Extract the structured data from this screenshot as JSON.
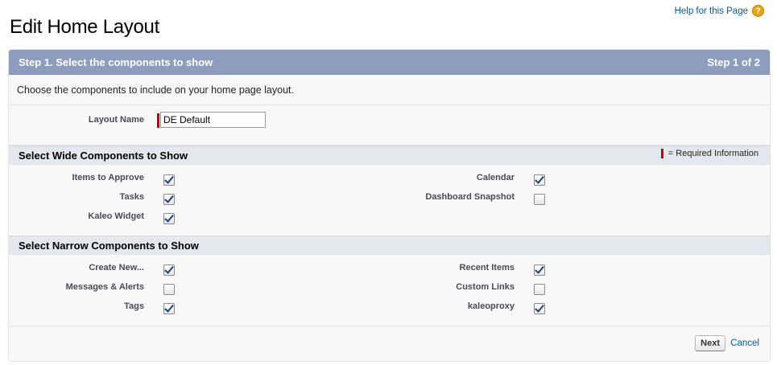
{
  "page": {
    "title": "Edit Home Layout",
    "help_link": "Help for this Page",
    "help_icon": "question-icon"
  },
  "step": {
    "title": "Step 1. Select the components to show",
    "indicator": "Step 1 of 2",
    "instructions": "Choose the components to include on your home page layout."
  },
  "layout_name": {
    "label": "Layout Name",
    "value": "DE Default"
  },
  "legend": "= Required Information",
  "wide": {
    "title": "Select Wide Components to Show",
    "items": [
      {
        "label": "Items to Approve",
        "checked": true
      },
      {
        "label": "Tasks",
        "checked": true
      },
      {
        "label": "Kaleo Widget",
        "checked": true
      },
      {
        "label": "Calendar",
        "checked": true
      },
      {
        "label": "Dashboard Snapshot",
        "checked": false
      }
    ]
  },
  "narrow": {
    "title": "Select Narrow Components to Show",
    "items": [
      {
        "label": "Create New...",
        "checked": true
      },
      {
        "label": "Messages & Alerts",
        "checked": false
      },
      {
        "label": "Tags",
        "checked": true
      },
      {
        "label": "Recent Items",
        "checked": true
      },
      {
        "label": "Custom Links",
        "checked": false
      },
      {
        "label": "kaleoproxy",
        "checked": true
      }
    ]
  },
  "buttons": {
    "next": "Next",
    "cancel": "Cancel"
  },
  "colors": {
    "header": "#8e9dbe",
    "section": "#e3e8ee",
    "link": "#015ba7",
    "required": "#cc0000"
  }
}
